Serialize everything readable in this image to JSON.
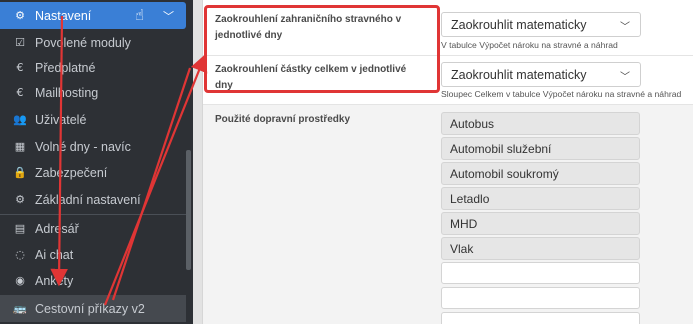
{
  "sidebar": {
    "active": {
      "label": "Nastavení",
      "icon": "cogs-icon"
    },
    "items": [
      {
        "label": "Povolené moduly",
        "icon": "checkbox-icon"
      },
      {
        "label": "Předplatné",
        "icon": "euro-icon"
      },
      {
        "label": "Mailhosting",
        "icon": "euro-icon"
      },
      {
        "label": "Uživatelé",
        "icon": "users-icon"
      },
      {
        "label": "Volné dny - navíc",
        "icon": "calendar-icon"
      },
      {
        "label": "Zabezpečení",
        "icon": "lock-icon"
      },
      {
        "label": "Základní nastavení",
        "icon": "cogs-icon"
      }
    ],
    "items2": [
      {
        "label": "Adresář",
        "icon": "book-icon"
      },
      {
        "label": "Ai chat",
        "icon": "chat-icon"
      },
      {
        "label": "Ankety",
        "icon": "target-icon"
      },
      {
        "label": "Cestovní příkazy v2",
        "icon": "bus-icon"
      }
    ]
  },
  "form": {
    "row1": {
      "label": "Zaokrouhlení zahraničního stravného v jednotlivé dny",
      "value": "Zaokrouhlit matematicky",
      "hint": "V tabulce Výpočet nároku na stravné a náhrad"
    },
    "row2": {
      "label": "Zaokrouhlení částky celkem v jednotlivé dny",
      "value": "Zaokrouhlit matematicky",
      "hint": "Sloupec Celkem v tabulce Výpočet nároku na stravné a náhrad"
    },
    "transport": {
      "label": "Použité dopravní prostředky",
      "items": [
        "Autobus",
        "Automobil služební",
        "Automobil soukromý",
        "Letadlo",
        "MHD",
        "Vlak"
      ]
    }
  },
  "colors": {
    "active": "#3a7fd6",
    "sidebar": "#2d3035",
    "annotation": "#e03535"
  }
}
